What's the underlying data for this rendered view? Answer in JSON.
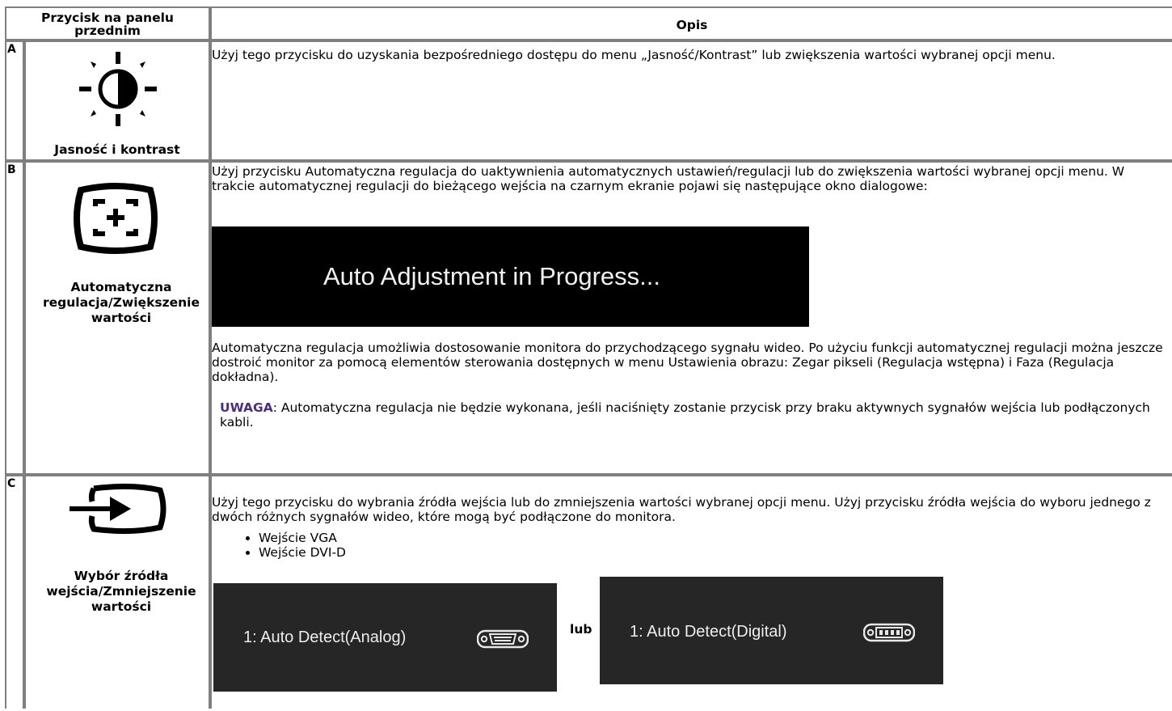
{
  "header": {
    "col1": "Przycisk na panelu przednim",
    "col2": "Opis"
  },
  "rows": [
    {
      "letter": "A",
      "icon": "brightness-contrast-icon",
      "label": "Jasność i kontrast",
      "desc": "Użyj tego przycisku do uzyskania bezpośredniego dostępu do menu „Jasność/Kontrast” lub zwiększenia wartości wybranej opcji menu."
    },
    {
      "letter": "B",
      "icon": "auto-adjust-icon",
      "label": "Automatyczna regulacja/Zwiększenie wartości",
      "desc": "Użyj przycisku Automatyczna regulacja do uaktywnienia automatycznych ustawień/regulacji lub do zwiększenia wartości wybranej opcji menu. W trakcie automatycznej regulacji do bieżącego wejścia na czarnym ekranie pojawi się następujące okno dialogowe:",
      "osd_text": "Auto Adjustment in Progress...",
      "desc2": "Automatyczna regulacja umożliwia dostosowanie monitora do przychodzącego sygnału wideo. Po użyciu funkcji automatycznej regulacji można jeszcze dostroić monitor za pomocą elementów sterowania dostępnych w menu Ustawienia obrazu: Zegar pikseli (Regulacja wstępna) i Faza (Regulacja dokładna).",
      "note_label": "UWAGA",
      "note_text": ": Automatyczna regulacja nie będzie wykonana, jeśli naciśnięty zostanie przycisk przy braku aktywnych sygnałów wejścia lub podłączonych kabli."
    },
    {
      "letter": "C",
      "icon": "input-source-icon",
      "label": "Wybór źródła wejścia/Zmniejszenie wartości",
      "desc": "Użyj tego przycisku do wybrania źródła wejścia lub do zmniejszenia wartości wybranej opcji menu. Użyj przycisku źródła wejścia do wyboru jednego z dwóch różnych sygnałów wideo, które mogą być podłączone do monitora.",
      "inputs": [
        "Wejście VGA",
        "Wejście DVI-D"
      ],
      "osd_analog": "1: Auto Detect(Analog)",
      "osd_or": "lub",
      "osd_digital": "1: Auto Detect(Digital)"
    }
  ],
  "colors": {
    "grid": "#7f7f7f",
    "note": "#4b2e83",
    "osd_bg": "#262626"
  }
}
